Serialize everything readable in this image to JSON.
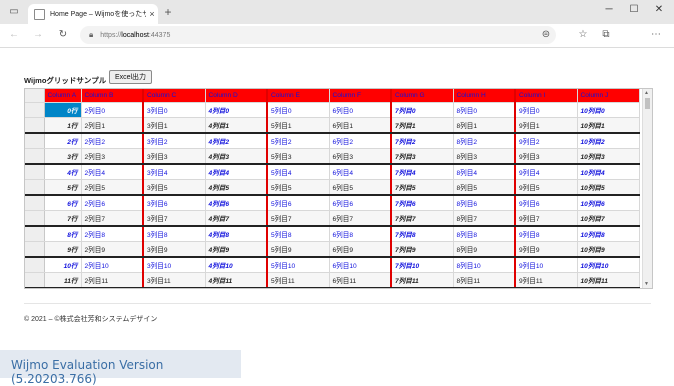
{
  "browser": {
    "tab_title": "Home Page – Wijmoを使ったサンプ",
    "tab_close": "×",
    "new_tab": "+",
    "url_scheme": "https://",
    "url_host": "localhost",
    "url_port": ":44375",
    "window_controls": {
      "minimize": "─",
      "maximize": "☐",
      "close": "✕"
    }
  },
  "page": {
    "heading": "Wijmoグリッドサンプル",
    "export_button": "Excel出力",
    "footer": "© 2021 – ©株式会社芳和システムデザイン",
    "eval_banner": "Wijmo Evaluation Version (5.20203.766)"
  },
  "grid": {
    "columns": [
      "Column A",
      "Column B",
      "Column C",
      "Column D",
      "Column E",
      "Column F",
      "Column G",
      "Column H",
      "Column I",
      "Column J"
    ],
    "rows": [
      [
        "0行",
        "2列目0",
        "3列目0",
        "4列目0",
        "5列目0",
        "6列目0",
        "7列目0",
        "8列目0",
        "9列目0",
        "10列目0"
      ],
      [
        "1行",
        "2列目1",
        "3列目1",
        "4列目1",
        "5列目1",
        "6列目1",
        "7列目1",
        "8列目1",
        "9列目1",
        "10列目1"
      ],
      [
        "2行",
        "2列目2",
        "3列目2",
        "4列目2",
        "5列目2",
        "6列目2",
        "7列目2",
        "8列目2",
        "9列目2",
        "10列目2"
      ],
      [
        "3行",
        "2列目3",
        "3列目3",
        "4列目3",
        "5列目3",
        "6列目3",
        "7列目3",
        "8列目3",
        "9列目3",
        "10列目3"
      ],
      [
        "4行",
        "2列目4",
        "3列目4",
        "4列目4",
        "5列目4",
        "6列目4",
        "7列目4",
        "8列目4",
        "9列目4",
        "10列目4"
      ],
      [
        "5行",
        "2列目5",
        "3列目5",
        "4列目5",
        "5列目5",
        "6列目5",
        "7列目5",
        "8列目5",
        "9列目5",
        "10列目5"
      ],
      [
        "6行",
        "2列目6",
        "3列目6",
        "4列目6",
        "5列目6",
        "6列目6",
        "7列目6",
        "8列目6",
        "9列目6",
        "10列目6"
      ],
      [
        "7行",
        "2列目7",
        "3列目7",
        "4列目7",
        "5列目7",
        "6列目7",
        "7列目7",
        "8列目7",
        "9列目7",
        "10列目7"
      ],
      [
        "8行",
        "2列目8",
        "3列目8",
        "4列目8",
        "5列目8",
        "6列目8",
        "7列目8",
        "8列目8",
        "9列目8",
        "10列目8"
      ],
      [
        "9行",
        "2列目9",
        "3列目9",
        "4列目9",
        "5列目9",
        "6列目9",
        "7列目9",
        "8列目9",
        "9列目9",
        "10列目9"
      ],
      [
        "10行",
        "2列目10",
        "3列目10",
        "4列目10",
        "5列目10",
        "6列目10",
        "7列目10",
        "8列目10",
        "9列目10",
        "10列目10"
      ],
      [
        "11行",
        "2列目11",
        "3列目11",
        "4列目11",
        "5列目11",
        "6列目11",
        "7列目11",
        "8列目11",
        "9列目11",
        "10列目11"
      ]
    ],
    "header_bg": "#ff0000",
    "selection_bg": "#0085c7",
    "even_text_color": "#1111dd",
    "odd_text_color": "#222222"
  }
}
